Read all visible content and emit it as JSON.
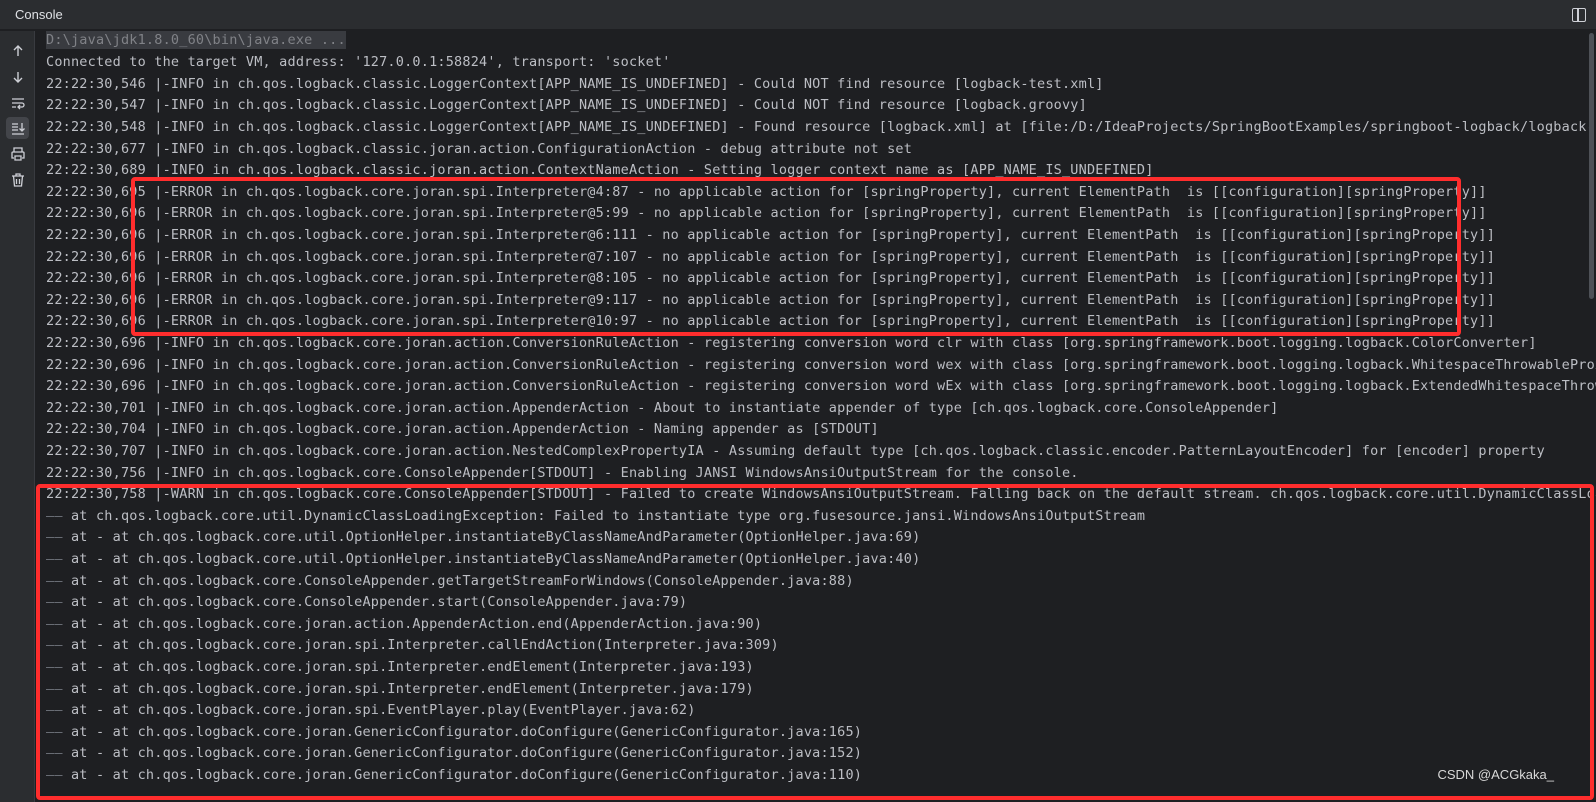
{
  "window": {
    "title": "Console"
  },
  "toolbar": {
    "icons": [
      "arrow-up-icon",
      "arrow-down-icon",
      "soft-wrap-icon",
      "scroll-to-end-icon",
      "print-icon",
      "trash-icon"
    ]
  },
  "console": {
    "command": "D:\\java\\jdk1.8.0_60\\bin\\java.exe ...",
    "lines": [
      "Connected to the target VM, address: '127.0.0.1:58824', transport: 'socket'",
      "22:22:30,546 |-INFO in ch.qos.logback.classic.LoggerContext[APP_NAME_IS_UNDEFINED] - Could NOT find resource [logback-test.xml]",
      "22:22:30,547 |-INFO in ch.qos.logback.classic.LoggerContext[APP_NAME_IS_UNDEFINED] - Could NOT find resource [logback.groovy]",
      "22:22:30,548 |-INFO in ch.qos.logback.classic.LoggerContext[APP_NAME_IS_UNDEFINED] - Found resource [logback.xml] at [file:/D:/IdeaProjects/SpringBootExamples/springboot-logback/logback-integrat",
      "22:22:30,677 |-INFO in ch.qos.logback.classic.joran.action.ConfigurationAction - debug attribute not set",
      "22:22:30,689 |-INFO in ch.qos.logback.classic.joran.action.ContextNameAction - Setting logger context name as [APP_NAME_IS_UNDEFINED]",
      "22:22:30,695 |-ERROR in ch.qos.logback.core.joran.spi.Interpreter@4:87 - no applicable action for [springProperty], current ElementPath  is [[configuration][springProperty]]",
      "22:22:30,696 |-ERROR in ch.qos.logback.core.joran.spi.Interpreter@5:99 - no applicable action for [springProperty], current ElementPath  is [[configuration][springProperty]]",
      "22:22:30,696 |-ERROR in ch.qos.logback.core.joran.spi.Interpreter@6:111 - no applicable action for [springProperty], current ElementPath  is [[configuration][springProperty]]",
      "22:22:30,696 |-ERROR in ch.qos.logback.core.joran.spi.Interpreter@7:107 - no applicable action for [springProperty], current ElementPath  is [[configuration][springProperty]]",
      "22:22:30,696 |-ERROR in ch.qos.logback.core.joran.spi.Interpreter@8:105 - no applicable action for [springProperty], current ElementPath  is [[configuration][springProperty]]",
      "22:22:30,696 |-ERROR in ch.qos.logback.core.joran.spi.Interpreter@9:117 - no applicable action for [springProperty], current ElementPath  is [[configuration][springProperty]]",
      "22:22:30,696 |-ERROR in ch.qos.logback.core.joran.spi.Interpreter@10:97 - no applicable action for [springProperty], current ElementPath  is [[configuration][springProperty]]",
      "22:22:30,696 |-INFO in ch.qos.logback.core.joran.action.ConversionRuleAction - registering conversion word clr with class [org.springframework.boot.logging.logback.ColorConverter]",
      "22:22:30,696 |-INFO in ch.qos.logback.core.joran.action.ConversionRuleAction - registering conversion word wex with class [org.springframework.boot.logging.logback.WhitespaceThrowableProxyConver",
      "22:22:30,696 |-INFO in ch.qos.logback.core.joran.action.ConversionRuleAction - registering conversion word wEx with class [org.springframework.boot.logging.logback.ExtendedWhitespaceThrowablePro",
      "22:22:30,701 |-INFO in ch.qos.logback.core.joran.action.AppenderAction - About to instantiate appender of type [ch.qos.logback.core.ConsoleAppender]",
      "22:22:30,704 |-INFO in ch.qos.logback.core.joran.action.AppenderAction - Naming appender as [STDOUT]",
      "22:22:30,707 |-INFO in ch.qos.logback.core.joran.action.NestedComplexPropertyIA - Assuming default type [ch.qos.logback.classic.encoder.PatternLayoutEncoder] for [encoder] property",
      "22:22:30,756 |-INFO in ch.qos.logback.core.ConsoleAppender[STDOUT] - Enabling JANSI WindowsAnsiOutputStream for the console.",
      "22:22:30,758 |-WARN in ch.qos.logback.core.ConsoleAppender[STDOUT] - Failed to create WindowsAnsiOutputStream. Falling back on the default stream. ch.qos.logback.core.util.DynamicClassLoadingEx"
    ],
    "trace_dash": "——",
    "trace": [
      "at ch.qos.logback.core.util.DynamicClassLoadingException: Failed to instantiate type org.fusesource.jansi.WindowsAnsiOutputStream",
      "at - at ch.qos.logback.core.util.OptionHelper.instantiateByClassNameAndParameter(OptionHelper.java:69)",
      "at - at ch.qos.logback.core.util.OptionHelper.instantiateByClassNameAndParameter(OptionHelper.java:40)",
      "at - at ch.qos.logback.core.ConsoleAppender.getTargetStreamForWindows(ConsoleAppender.java:88)",
      "at - at ch.qos.logback.core.ConsoleAppender.start(ConsoleAppender.java:79)",
      "at - at ch.qos.logback.core.joran.action.AppenderAction.end(AppenderAction.java:90)",
      "at - at ch.qos.logback.core.joran.spi.Interpreter.callEndAction(Interpreter.java:309)",
      "at - at ch.qos.logback.core.joran.spi.Interpreter.endElement(Interpreter.java:193)",
      "at - at ch.qos.logback.core.joran.spi.Interpreter.endElement(Interpreter.java:179)",
      "at - at ch.qos.logback.core.joran.spi.EventPlayer.play(EventPlayer.java:62)",
      "at - at ch.qos.logback.core.joran.GenericConfigurator.doConfigure(GenericConfigurator.java:165)",
      "at - at ch.qos.logback.core.joran.GenericConfigurator.doConfigure(GenericConfigurator.java:152)",
      "at - at ch.qos.logback.core.joran.GenericConfigurator.doConfigure(GenericConfigurator.java:110)"
    ]
  },
  "watermark": "CSDN @ACGkaka_",
  "colors": {
    "highlight": "#ff2d2d",
    "background": "#1e1f22",
    "text": "#bcbec4"
  }
}
